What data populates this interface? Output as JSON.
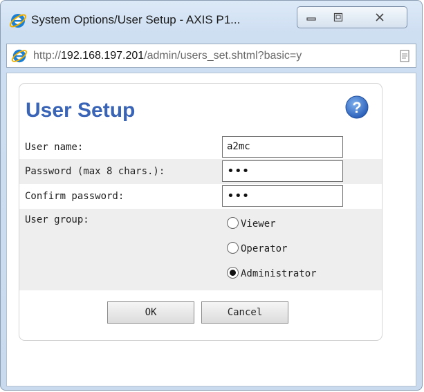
{
  "window": {
    "title": "System Options/User Setup - AXIS P1..."
  },
  "address_bar": {
    "url_prefix": "http://",
    "url_host": "192.168.197.201",
    "url_path": "/admin/users_set.shtml?basic=y"
  },
  "form": {
    "heading": "User Setup",
    "user_name_label": "User name:",
    "user_name_value": "a2mc",
    "password_label": "Password (max 8 chars.):",
    "password_value": "•••",
    "confirm_label": "Confirm password:",
    "confirm_value": "•••",
    "group_label": "User group:",
    "groups": [
      {
        "label": "Viewer",
        "checked": false
      },
      {
        "label": "Operator",
        "checked": false
      },
      {
        "label": "Administrator",
        "checked": true
      }
    ],
    "ok_label": "OK",
    "cancel_label": "Cancel"
  },
  "colors": {
    "heading": "#3a64b6",
    "help_icon": "#3a6fc4",
    "ie_icon": "#1b7fd4"
  },
  "icons": {
    "app": "internet-explorer-icon",
    "help": "help-icon",
    "minimize": "minimize-icon",
    "maximize": "maximize-icon",
    "close": "close-icon",
    "page": "page-icon"
  }
}
